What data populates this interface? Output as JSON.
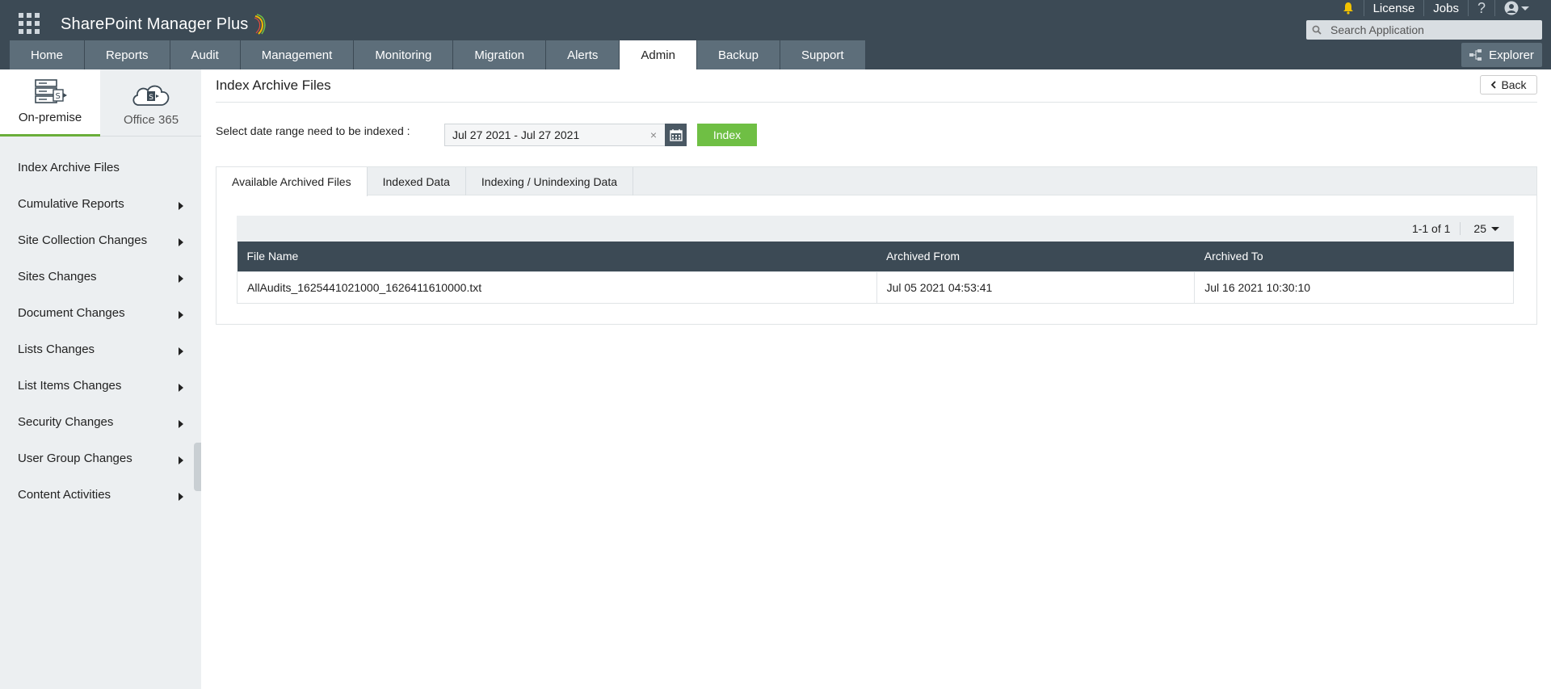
{
  "app": {
    "title": "SharePoint Manager Plus",
    "top_links": [
      "License",
      "Jobs"
    ],
    "help_label": "?",
    "search_placeholder": "Search Application",
    "explorer_label": "Explorer"
  },
  "nav": {
    "tabs": [
      "Home",
      "Reports",
      "Audit",
      "Management",
      "Monitoring",
      "Migration",
      "Alerts",
      "Admin",
      "Backup",
      "Support"
    ],
    "active": "Admin"
  },
  "sidebar": {
    "modes": [
      {
        "label": "On-premise",
        "icon": "server-icon",
        "active": true
      },
      {
        "label": "Office 365",
        "icon": "cloud-icon",
        "active": false
      }
    ],
    "items": [
      {
        "label": "Index Archive Files",
        "expandable": false
      },
      {
        "label": "Cumulative Reports",
        "expandable": true
      },
      {
        "label": "Site Collection Changes",
        "expandable": true
      },
      {
        "label": "Sites Changes",
        "expandable": true
      },
      {
        "label": "Document Changes",
        "expandable": true
      },
      {
        "label": "Lists Changes",
        "expandable": true
      },
      {
        "label": "List Items Changes",
        "expandable": true
      },
      {
        "label": "Security Changes",
        "expandable": true
      },
      {
        "label": "User Group Changes",
        "expandable": true
      },
      {
        "label": "Content Activities",
        "expandable": true
      }
    ]
  },
  "main": {
    "title": "Index Archive Files",
    "back_label": "Back",
    "range_label": "Select date range need to be indexed :",
    "date_range": "Jul 27 2021 - Jul 27 2021",
    "clear_glyph": "×",
    "index_button": "Index",
    "subtabs": [
      "Available Archived Files",
      "Indexed Data",
      "Indexing / Unindexing Data"
    ],
    "active_subtab": "Available Archived Files",
    "pager": {
      "range": "1-1 of 1",
      "per_page": "25"
    },
    "table": {
      "columns": [
        "File Name",
        "Archived From",
        "Archived To"
      ],
      "rows": [
        [
          "AllAudits_1625441021000_1626411610000.txt",
          "Jul 05 2021 04:53:41",
          "Jul 16 2021 10:30:10"
        ]
      ]
    }
  },
  "colors": {
    "header_bg": "#3c4a55",
    "tab_bg": "#5d6e7a",
    "accent_green": "#6fbf44",
    "sidebar_bg": "#eceff1"
  }
}
